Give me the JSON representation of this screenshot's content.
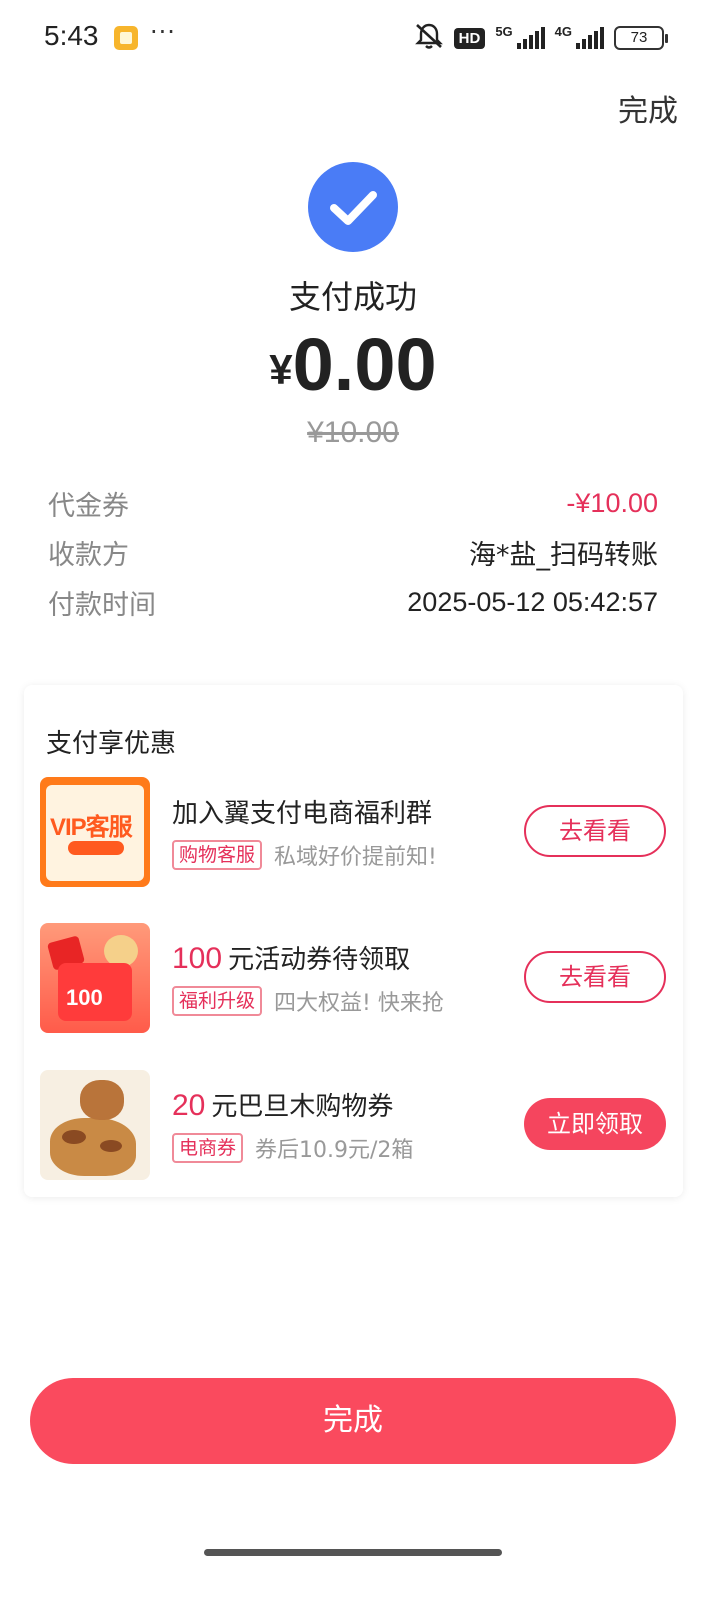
{
  "status_bar": {
    "time": "5:43",
    "dots": "···",
    "hd_label": "HD",
    "net_5g": "5G",
    "net_4g": "4G",
    "battery": "73",
    "icons": [
      "app-notification-icon",
      "mute-icon",
      "signal-icon",
      "battery-icon"
    ]
  },
  "header": {
    "done_label": "完成"
  },
  "result": {
    "status": "支付成功",
    "currency": "¥",
    "paid_amount": "0.00",
    "original_amount": "¥10.00",
    "accent": "#4a7cf6"
  },
  "details": [
    {
      "label": "代金券",
      "value": "-¥10.00"
    },
    {
      "label": "收款方",
      "value": "海*盐_扫码转账"
    },
    {
      "label": "付款时间",
      "value": "2025-05-12 05:42:57"
    }
  ],
  "promo": {
    "title": "支付享优惠",
    "items": [
      {
        "title": "加入翼支付电商福利群",
        "tag": "购物客服",
        "subtitle": "私域好价提前知!",
        "button": "去看看",
        "thumb_text": "VIP客服"
      },
      {
        "highlight": "100",
        "title": "元活动券待领取",
        "tag": "福利升级",
        "subtitle": "四大权益! 快来抢",
        "button": "去看看",
        "thumb_text": "100"
      },
      {
        "highlight": "20",
        "title": "元巴旦木购物券",
        "tag": "电商券",
        "subtitle": "券后10.9元/2箱",
        "button": "立即领取"
      }
    ]
  },
  "footer": {
    "done_button": "完成",
    "accent": "#fa4a5e"
  }
}
